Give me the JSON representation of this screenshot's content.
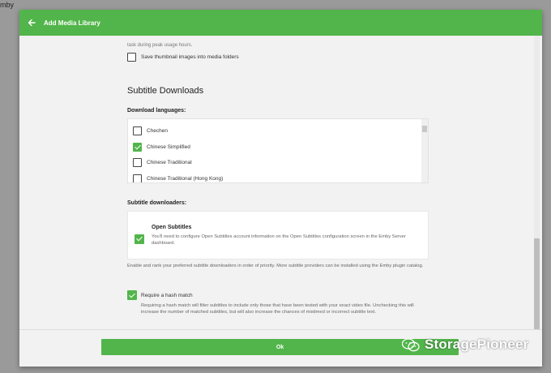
{
  "background": {
    "app_fragment": "mby"
  },
  "dialog": {
    "title": "Add Media Library",
    "back_icon": "arrow-left-icon",
    "accent_color": "#52b54b"
  },
  "content": {
    "faded_text": "task during peak usage hours.",
    "thumbnail_option": {
      "label": "Save thumbnail images into media folders",
      "checked": false
    },
    "subtitle_section": {
      "title": "Subtitle Downloads",
      "languages_label": "Download languages:",
      "languages": [
        {
          "label": "Chechen",
          "checked": false
        },
        {
          "label": "Chinese Simplified",
          "checked": true
        },
        {
          "label": "Chinese Traditional",
          "checked": false
        },
        {
          "label": "Chinese Traditional (Hong Kong)",
          "checked": false
        }
      ],
      "downloaders_label": "Subtitle downloaders:",
      "downloader": {
        "name": "Open Subtitles",
        "description": "You'll need to configure Open Subtitles account information on the Open Subtitles configuration screen in the Emby Server dashboard.",
        "checked": true
      },
      "downloaders_help": "Enable and rank your preferred subtitle downloaders in order of priority. More subtitle providers can be installed using the Emby plugin catalog.",
      "hash_match": {
        "label": "Require a hash match",
        "checked": true,
        "description": "Requiring a hash match will filter subtitles to include only those that have been tested with your exact video file. Unchecking this will increase the number of matched subtitles, but will also increase the chances of mistimed or incorrect subtitle text."
      }
    }
  },
  "footer": {
    "ok_label": "Ok"
  },
  "watermark": {
    "text": "StoragePioneer",
    "icon": "wechat-icon"
  }
}
